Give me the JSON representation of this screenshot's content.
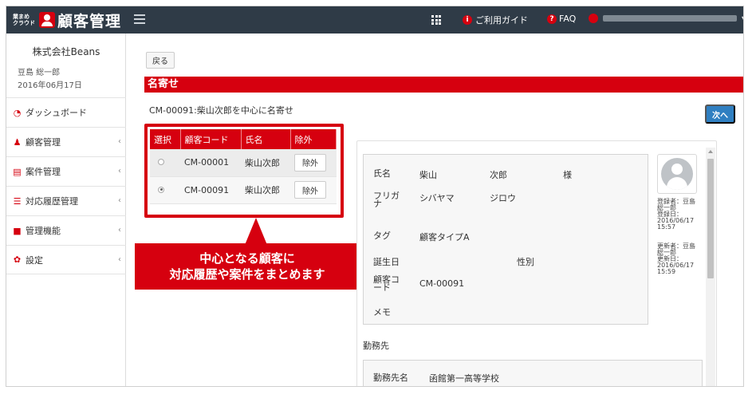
{
  "header": {
    "logo_small": "業まめ クラウド",
    "title": "顧客管理",
    "guide_label": "ご利用ガイド",
    "faq_label": "FAQ"
  },
  "sidebar": {
    "company": "株式会社Beans",
    "person": "豆島 総一郎",
    "date": "2016年06月17日",
    "items": [
      {
        "label": "ダッシュボード",
        "icon": "dashboard-icon"
      },
      {
        "label": "顧客管理",
        "icon": "users-icon"
      },
      {
        "label": "案件管理",
        "icon": "book-icon"
      },
      {
        "label": "対応履歴管理",
        "icon": "list-icon"
      },
      {
        "label": "管理機能",
        "icon": "grid-icon"
      },
      {
        "label": "設定",
        "icon": "gear-icon"
      }
    ]
  },
  "main": {
    "back_label": "戻る",
    "section_title": "名寄せ",
    "subtitle": "CM-00091:柴山次郎を中心に名寄せ",
    "next_label": "次へ",
    "table": {
      "headers": [
        "選択",
        "顧客コード",
        "氏名",
        "除外"
      ],
      "rows": [
        {
          "code": "CM-00001",
          "name": "柴山次郎",
          "action": "除外",
          "selected": false
        },
        {
          "code": "CM-00091",
          "name": "柴山次郎",
          "action": "除外",
          "selected": true
        }
      ]
    },
    "callout": {
      "line1": "中心となる顧客に",
      "line2": "対応履歴や案件をまとめます"
    }
  },
  "detail": {
    "name_label": "氏名",
    "last_name": "柴山",
    "first_name": "次郎",
    "honorific": "様",
    "kana_label_1": "フリガ",
    "kana_label_2": "ナ",
    "last_kana": "シバヤマ",
    "first_kana": "ジロウ",
    "tag_label": "タグ",
    "tag_value": "顧客タイプA",
    "birthday_label": "誕生日",
    "gender_label": "性別",
    "code_label_1": "顧客コ",
    "code_label_2": "ード",
    "code_value": "CM-00091",
    "memo_label": "メモ",
    "meta_registrant": [
      "登録者：豆島",
      "総一郎"
    ],
    "meta_registered": [
      "登録日：",
      "2016/06/17",
      "15:57"
    ],
    "meta_updater": [
      "更新者：豆島",
      "総一郎"
    ],
    "meta_updated": [
      "更新日：",
      "2016/06/17",
      "15:59"
    ],
    "workplace_label": "勤務先",
    "workplace_name_label": "勤務先名",
    "workplace_name": "函館第一高等学校"
  },
  "colors": {
    "accent": "#d6000f",
    "topbar": "#2f3b47",
    "primary_button": "#2f7fc1"
  }
}
